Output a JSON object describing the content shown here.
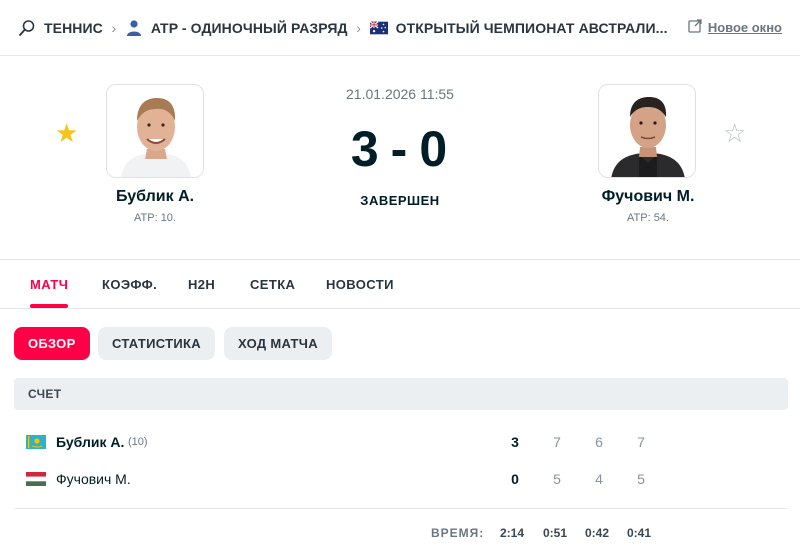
{
  "breadcrumb": {
    "sport": "ТЕННИС",
    "category": "ATP - ОДИНОЧНЫЙ РАЗРЯД",
    "tournament": "ОТКРЫТЫЙ ЧЕМПИОНАТ АВСТРАЛИ...",
    "new_window": "Новое окно"
  },
  "match": {
    "datetime": "21.01.2026 11:55",
    "score_home": "3",
    "score_sep": "-",
    "score_away": "0",
    "status": "ЗАВЕРШЕН",
    "home": {
      "name": "Бублик А.",
      "rank": "ATP: 10.",
      "favorite": true
    },
    "away": {
      "name": "Фучович М.",
      "rank": "ATP: 54.",
      "favorite": false
    }
  },
  "tabs": [
    "МАТЧ",
    "КОЭФФ.",
    "H2H",
    "СЕТКА",
    "НОВОСТИ"
  ],
  "subtabs": [
    "ОБЗОР",
    "СТАТИСТИКА",
    "ХОД МАТЧА"
  ],
  "score_section": {
    "title": "СЧЕТ",
    "rows": [
      {
        "name": "Бублик А.",
        "seed": "(10)",
        "flag": "kazakhstan-flag",
        "total": "3",
        "sets": [
          "7",
          "6",
          "7"
        ]
      },
      {
        "name": "Фучович М.",
        "seed": "",
        "flag": "hungary-flag",
        "total": "0",
        "sets": [
          "5",
          "4",
          "5"
        ]
      }
    ],
    "time_label": "ВРЕМЯ:",
    "times": [
      "2:14",
      "0:51",
      "0:42",
      "0:41"
    ]
  },
  "colors": {
    "accent": "#ff0046",
    "star_on": "#f5c518",
    "star_off": "#b9c0c6"
  }
}
